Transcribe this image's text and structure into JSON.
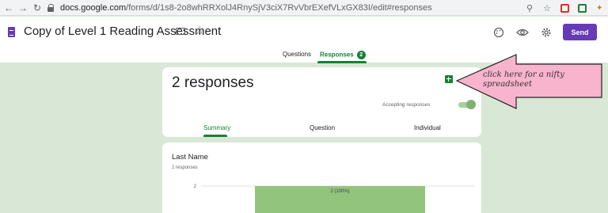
{
  "browser": {
    "url_host": "docs.google.com",
    "url_path": "/forms/d/1s8-2o8whRRXolJ4RnySjV3ciX7RvVbrEXefVLxGX83I/edit#responses"
  },
  "header": {
    "title": "Copy of Level 1 Reading Assessment",
    "send_label": "Send",
    "tabs": [
      {
        "label": "Questions"
      },
      {
        "label": "Responses",
        "badge": "2"
      }
    ]
  },
  "summary": {
    "count_text": "2 responses",
    "accepting_label": "Accepting responses",
    "accepting_enabled": true,
    "sub_tabs": [
      {
        "label": "Summary"
      },
      {
        "label": "Question"
      },
      {
        "label": "Individual"
      }
    ]
  },
  "question_card": {
    "title": "Last Name",
    "subtitle": "2 responses"
  },
  "chart_data": {
    "type": "bar",
    "y_tick_labels": [
      "2"
    ],
    "series": [
      {
        "values": [
          2
        ],
        "labels": [
          "2 (100%)"
        ]
      }
    ],
    "ylim": [
      0,
      2
    ],
    "color": "#93c47d",
    "grid": true
  },
  "annotation": {
    "text": "click here for a nifty spreadsheet"
  },
  "colors": {
    "accent": "#673ab7",
    "green": "#188038",
    "background": "#d9e8d6",
    "callout": "#f8b4cc"
  }
}
